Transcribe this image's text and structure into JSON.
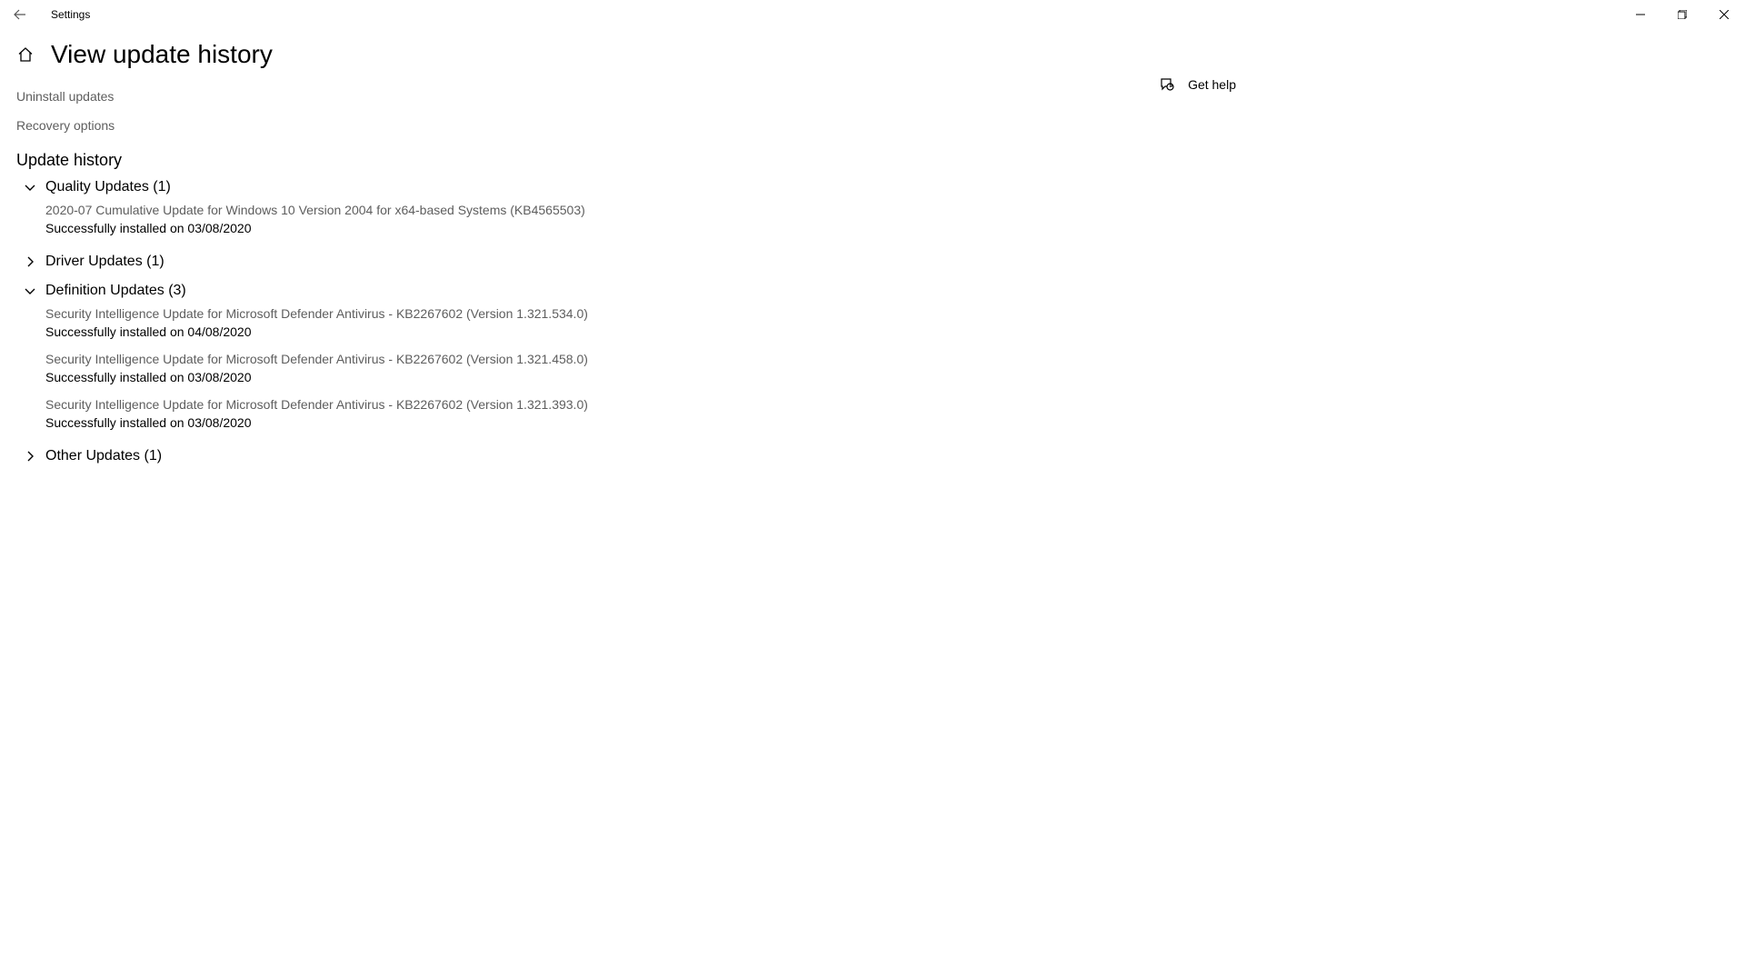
{
  "titlebar": {
    "app_name": "Settings"
  },
  "header": {
    "title": "View update history"
  },
  "links": {
    "uninstall": "Uninstall updates",
    "recovery": "Recovery options"
  },
  "help": {
    "label": "Get help"
  },
  "history": {
    "heading": "Update history",
    "groups": {
      "quality": {
        "label": "Quality Updates (1)"
      },
      "driver": {
        "label": "Driver Updates (1)"
      },
      "definition": {
        "label": "Definition Updates (3)"
      },
      "other": {
        "label": "Other Updates (1)"
      }
    },
    "quality_items": [
      {
        "title": "2020-07 Cumulative Update for Windows 10 Version 2004 for x64-based Systems (KB4565503)",
        "status": "Successfully installed on 03/08/2020"
      }
    ],
    "definition_items": [
      {
        "title": "Security Intelligence Update for Microsoft Defender Antivirus - KB2267602 (Version 1.321.534.0)",
        "status": "Successfully installed on 04/08/2020"
      },
      {
        "title": "Security Intelligence Update for Microsoft Defender Antivirus - KB2267602 (Version 1.321.458.0)",
        "status": "Successfully installed on 03/08/2020"
      },
      {
        "title": "Security Intelligence Update for Microsoft Defender Antivirus - KB2267602 (Version 1.321.393.0)",
        "status": "Successfully installed on 03/08/2020"
      }
    ]
  }
}
